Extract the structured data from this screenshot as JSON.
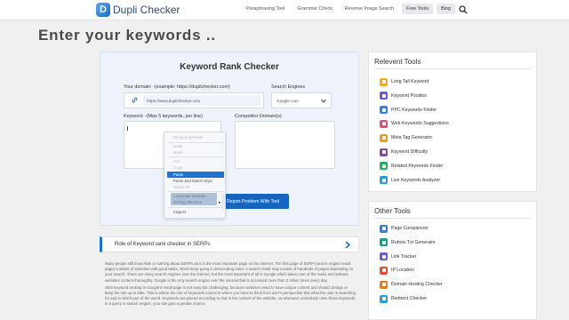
{
  "header": {
    "logo_mark": "D",
    "logo_text": "Dupli Checker",
    "nav": [
      {
        "label": "Paraphrasing Tool",
        "boxed": false
      },
      {
        "label": "Grammar Check",
        "boxed": false
      },
      {
        "label": "Reverse Image Search",
        "boxed": false
      },
      {
        "label": "Free Tools",
        "boxed": true
      },
      {
        "label": "Blog",
        "boxed": true
      }
    ]
  },
  "page_title": "Enter your keywords ..",
  "tool": {
    "title": "Keyword Rank Checker",
    "domain_label": "Your domain: -(example: https://duplichecker.com)",
    "domain_value": "https://www.duplichecker.com",
    "engine_label": "Search Engines",
    "engine_value": "Google.com",
    "keyword_label": "Keyword: -(Max 5 keywords, per line)",
    "competitor_label": "Competitor Domain(s)",
    "report_button": "Report Problem With Tool"
  },
  "context_menu": {
    "items": [
      {
        "label": "Emoji & Symbols",
        "state": "dim"
      },
      {
        "label": "Undo",
        "state": "dim"
      },
      {
        "label": "Redo",
        "state": "dim"
      },
      {
        "label": "Cut",
        "state": "dim"
      },
      {
        "label": "Copy",
        "state": "dim"
      },
      {
        "label": "Paste",
        "state": "highlight"
      },
      {
        "label": "Paste and Match Style",
        "state": "normal"
      },
      {
        "label": "Select All",
        "state": "dim"
      },
      {
        "label": "Language Settings",
        "state": "normal"
      },
      {
        "label": "Writing Direction",
        "state": "normal"
      },
      {
        "label": "Inspect",
        "state": "normal"
      }
    ]
  },
  "accordion": {
    "title": "Role of Keyword rank checker in SERPs"
  },
  "body": {
    "paragraphs": [
      "Many people still know little or nothing about SERPs as it is the most important page on the internet. The first page of SERP (search engine result page) consists of websites with good ranks, which keep going in descending order. A search result may consist of hundreds of pages depending on your search. There are many search engines over the internet, but the most important of all is Google which takes care of the ranks and indexes websites content thoroughly. Google is the only search engine over the internet that is accessed more than 3 billion times every day.",
      "SEO keyword ranking in Google's result page is not easy but challenging, because websites need to have unique content and should change or keep the site up to date. This is where the role of keywords comes in where you have to think from user's perspective that what the user is searching for and in which part of the world. Keywords are placed according to that in the content of the website, so whenever somebody uses those keywords in a query in search engine, your site gets a greater chance"
    ]
  },
  "sidebar": {
    "relevent_title": "Relevent Tools",
    "relevent_tools": [
      {
        "label": "Long Tail Keyword",
        "icon": "long-tail-keyword-icon",
        "color": "#f5a623"
      },
      {
        "label": "Keyword Position",
        "icon": "keyword-position-icon",
        "color": "#6b5bd6"
      },
      {
        "label": "PPC Keywords Finder",
        "icon": "ppc-keywords-icon",
        "color": "#2f80ed"
      },
      {
        "label": "Web Keywords Suggestions",
        "icon": "web-keywords-icon",
        "color": "#e94e77"
      },
      {
        "label": "Meta Tag Generator",
        "icon": "meta-tag-icon",
        "color": "#f39c12"
      },
      {
        "label": "Keyword Difficulty",
        "icon": "keyword-difficulty-icon",
        "color": "#8e44ad"
      },
      {
        "label": "Related Keywords Finder",
        "icon": "related-keywords-icon",
        "color": "#27ae60"
      },
      {
        "label": "Live Keywords Analyzer",
        "icon": "live-keywords-icon",
        "color": "#2d9cdb"
      }
    ],
    "other_title": "Other Tools",
    "other_tools": [
      {
        "label": "Page Comparison",
        "icon": "page-comparison-icon",
        "color": "#2f80ed"
      },
      {
        "label": "Robots Txt Generator",
        "icon": "robots-txt-icon",
        "color": "#16a085"
      },
      {
        "label": "Link Tracker",
        "icon": "link-tracker-icon",
        "color": "#6b5bd6"
      },
      {
        "label": "IP Location",
        "icon": "ip-location-icon",
        "color": "#e74c3c"
      },
      {
        "label": "Domain Hosting Checker",
        "icon": "domain-hosting-icon",
        "color": "#e67e22"
      },
      {
        "label": "Redirect Checker",
        "icon": "redirect-checker-icon",
        "color": "#2d9cdb"
      }
    ]
  }
}
